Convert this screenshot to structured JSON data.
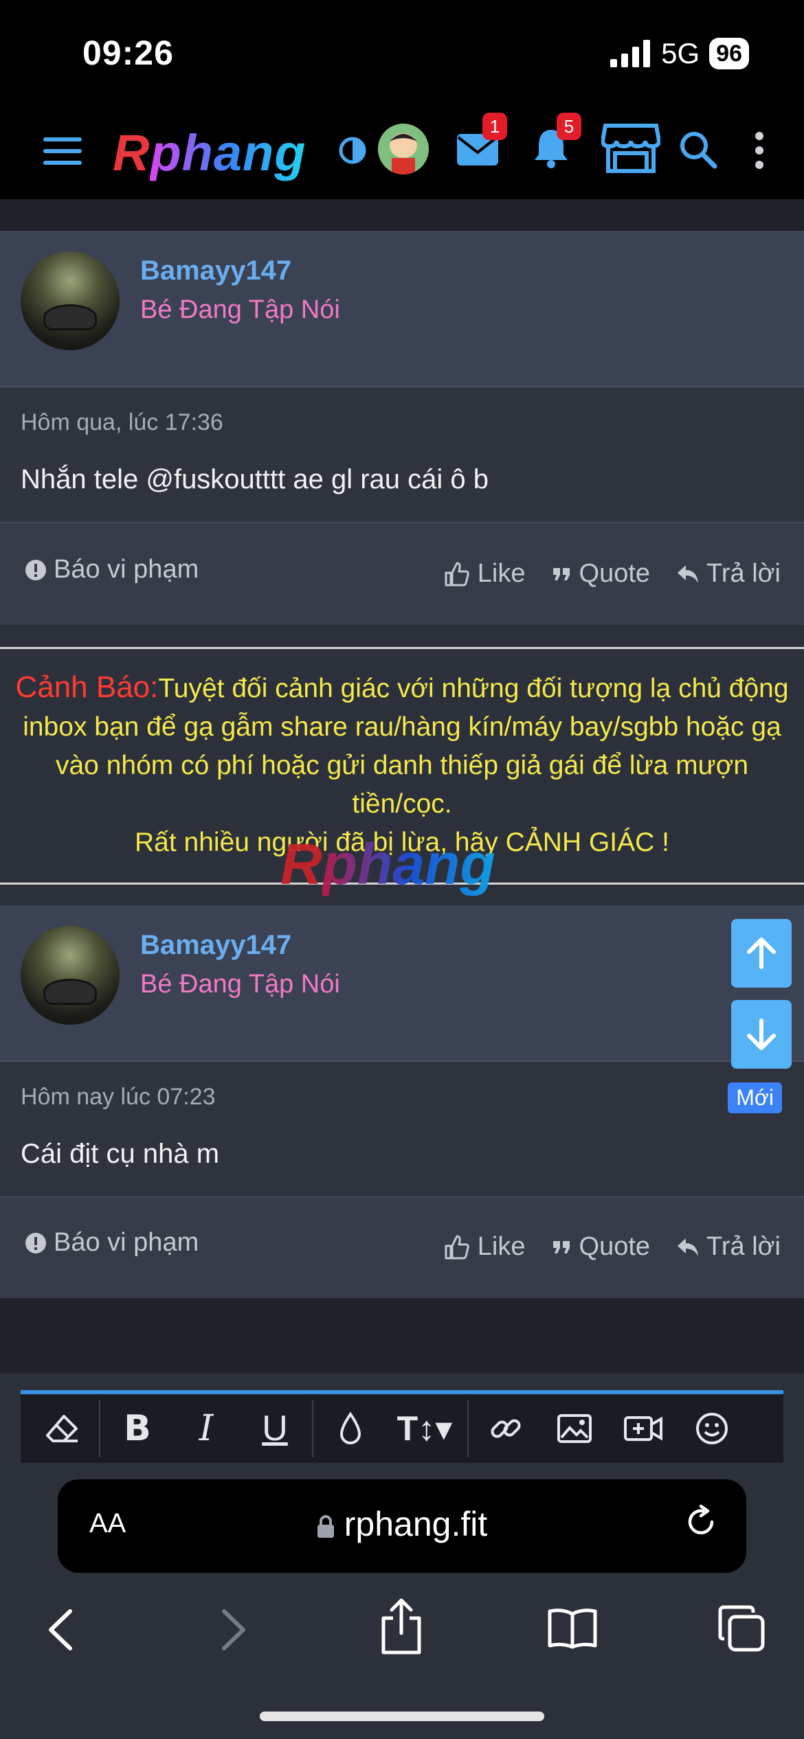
{
  "status_bar": {
    "time": "09:26",
    "network": "5G",
    "battery": "96"
  },
  "header": {
    "logo_r": "R",
    "logo_rest": "phang",
    "mail_badge": "1",
    "bell_badge": "5",
    "icons": [
      "menu-icon",
      "theme-toggle-icon",
      "avatar",
      "mail-icon",
      "bell-icon",
      "store-icon",
      "search-icon",
      "more-icon"
    ]
  },
  "posts": [
    {
      "username": "Bamayy147",
      "user_title": "Bé Đang Tập Nói",
      "time": "Hôm qua, lúc 17:36",
      "text": "Nhắn tele @fuskoutttt ae gl rau cái ô b",
      "is_new": false
    },
    {
      "username": "Bamayy147",
      "user_title": "Bé Đang Tập Nói",
      "time": "Hôm nay lúc 07:23",
      "text": "Cái địt cụ nhà m",
      "is_new": true,
      "new_label": "Mới"
    }
  ],
  "post_actions": {
    "report": "Báo vi phạm",
    "like": "Like",
    "quote": "Quote",
    "reply": "Trả lời"
  },
  "warning": {
    "heading": "Cảnh Báo:",
    "body": "Tuyệt đối cảnh giác với những đối tượng lạ chủ động inbox bạn để gạ gẫm share rau/hàng kín/máy bay/sgbb hoặc gạ vào nhóm có phí hoặc gửi danh thiếp giả gái để lừa mượn tiền/cọc.",
    "footer": "Rất nhiều người đã bị lừa, hãy CẢNH GIÁC !"
  },
  "watermark": {
    "r": "R",
    "rest": "phang"
  },
  "editor_toolbar": [
    "eraser-icon",
    "bold-icon",
    "italic-icon",
    "underline-icon",
    "color-icon",
    "font-size-icon",
    "link-icon",
    "image-icon",
    "video-icon",
    "emoji-icon"
  ],
  "safari": {
    "aa_label": "AA",
    "url": "rphang.fit"
  },
  "colors": {
    "username": "#6aaef0",
    "user_title": "#f07ac4",
    "warning_text": "#f5e84b",
    "warning_heading": "#ff3b30",
    "scroll_button": "#56b3f5",
    "new_badge": "#3b82f6"
  }
}
